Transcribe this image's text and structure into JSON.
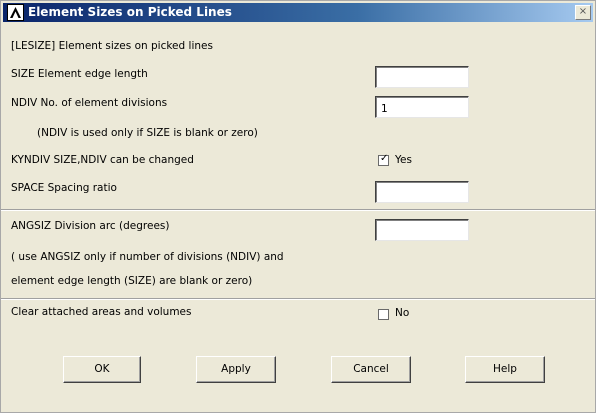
{
  "window": {
    "title": "Element Sizes on Picked Lines",
    "close_glyph": "×"
  },
  "header": {
    "text": "[LESIZE]  Element sizes on picked lines"
  },
  "rows": {
    "size": {
      "label": "SIZE   Element edge length",
      "value": ""
    },
    "ndiv": {
      "label": "NDIV   No. of element divisions",
      "value": "1"
    },
    "ndiv_note": "(NDIV is used only if SIZE is blank or zero)",
    "kyndiv": {
      "label": "KYNDIV  SIZE,NDIV can be changed",
      "checked": true,
      "check_glyph": "✓",
      "state_label": "Yes"
    },
    "space": {
      "label": "SPACE   Spacing ratio",
      "value": ""
    },
    "angsiz": {
      "label": "ANGSIZ  Division arc (degrees)",
      "value": ""
    },
    "angsiz_note_1": "( use ANGSIZ only if number of divisions (NDIV) and",
    "angsiz_note_2": "element edge length (SIZE) are blank or zero)",
    "clear": {
      "label": "Clear attached areas and volumes",
      "checked": false,
      "state_label": "No"
    }
  },
  "buttons": {
    "ok": "OK",
    "apply": "Apply",
    "cancel": "Cancel",
    "help": "Help"
  },
  "icons": {
    "app": "ansys-logo-icon",
    "close": "close-icon",
    "check": "checkmark-icon"
  },
  "colors": {
    "titlebar_start": "#0a246a",
    "titlebar_end": "#a6caf0",
    "dialog_bg": "#ece9d8"
  }
}
